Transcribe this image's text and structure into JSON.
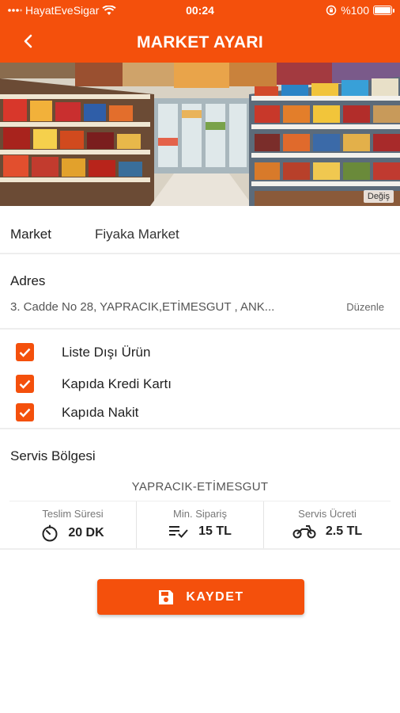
{
  "status_bar": {
    "carrier": "HayatEveSigar",
    "time": "00:24",
    "battery": "%100"
  },
  "header": {
    "title": "MARKET AYARI"
  },
  "banner": {
    "change_label": "Değiş"
  },
  "market": {
    "label": "Market",
    "value": "Fiyaka Market"
  },
  "address": {
    "label": "Adres",
    "value": "3. Cadde  No 28, YAPRACIK,ETİMESGUT , ANK...",
    "edit_label": "Düzenle"
  },
  "options": [
    {
      "label": "Liste Dışı Ürün",
      "checked": true
    },
    {
      "label": "Kapıda Kredi Kartı",
      "checked": true
    },
    {
      "label": "Kapıda Nakit",
      "checked": true
    }
  ],
  "service": {
    "label": "Servis Bölgesi",
    "region": "YAPRACIK-ETİMESGUT",
    "stats": [
      {
        "title": "Teslim Süresi",
        "value": "20 DK",
        "icon": "timer-icon"
      },
      {
        "title": "Min. Sipariş",
        "value": "15 TL",
        "icon": "list-check-icon"
      },
      {
        "title": "Servis Ücreti",
        "value": "2.5 TL",
        "icon": "motorcycle-icon"
      }
    ]
  },
  "save_button": {
    "label": "KAYDET",
    "icon": "save-icon"
  },
  "colors": {
    "accent": "#f4500c",
    "divider": "#eeeeee"
  }
}
